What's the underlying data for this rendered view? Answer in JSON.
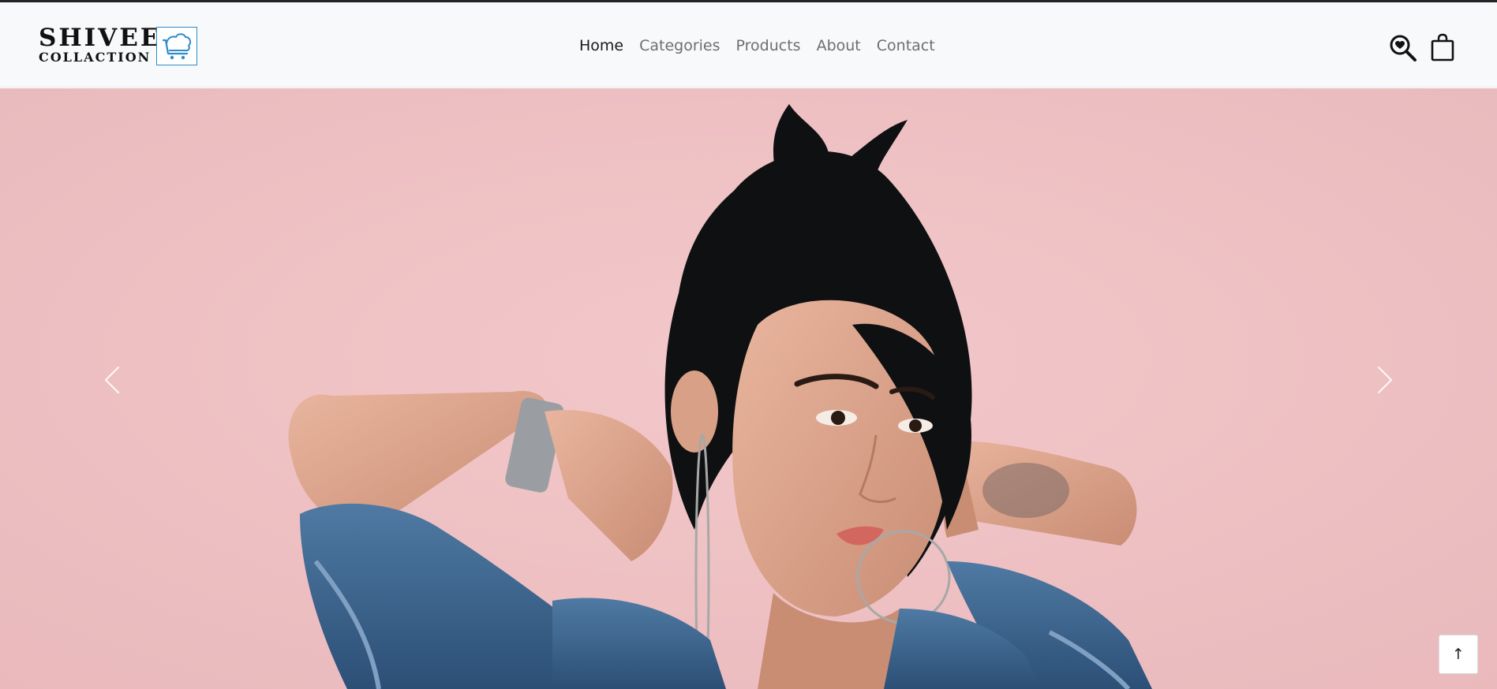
{
  "brand": {
    "line1": "SHIVEE",
    "line2": "COLLACTION",
    "logo_icon": "shopping-cart-icon",
    "accent_color": "#2f8bc9"
  },
  "nav": {
    "items": [
      {
        "label": "Home",
        "active": true
      },
      {
        "label": "Categories",
        "active": false
      },
      {
        "label": "Products",
        "active": false
      },
      {
        "label": "About",
        "active": false
      },
      {
        "label": "Contact",
        "active": false
      }
    ]
  },
  "actions": {
    "search_icon": "search-heart-icon",
    "bag_icon": "shopping-bag-icon"
  },
  "hero": {
    "background_color": "#f0c3c5",
    "prev_icon": "chevron-left-icon",
    "next_icon": "chevron-right-icon"
  },
  "back_to_top": {
    "label": "↑"
  }
}
